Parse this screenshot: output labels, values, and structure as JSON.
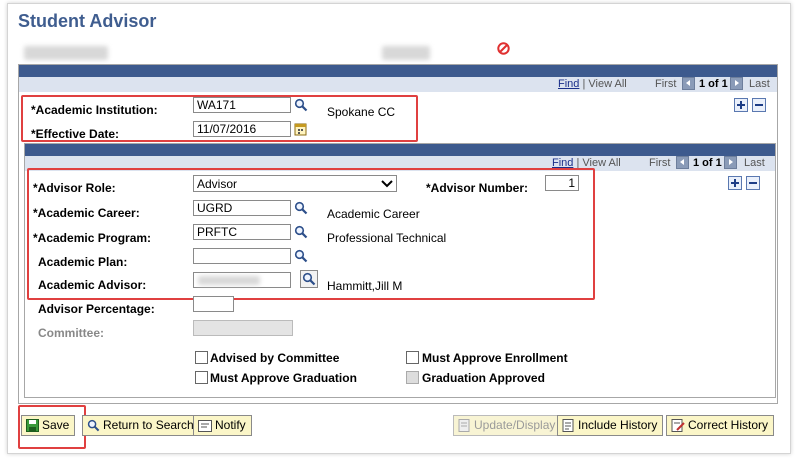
{
  "page": {
    "title": "Student Advisor"
  },
  "nav": {
    "find": "Find",
    "sep": "|",
    "view_all": "View All",
    "first": "First",
    "count": "1 of 1",
    "last": "Last"
  },
  "outer": {
    "institution_label": "*Academic Institution:",
    "institution_value": "WA171",
    "institution_desc": "Spokane CC",
    "effdate_label": "*Effective Date:",
    "effdate_value": "11/07/2016"
  },
  "inner": {
    "role_label": "*Advisor Role:",
    "role_value": "Advisor",
    "number_label": "*Advisor Number:",
    "number_value": "1",
    "career_label": "*Academic Career:",
    "career_value": "UGRD",
    "career_desc": "Academic Career",
    "program_label": "*Academic Program:",
    "program_value": "PRFTC",
    "program_desc": "Professional Technical",
    "plan_label": "Academic Plan:",
    "plan_value": "",
    "advisor_label": "Academic Advisor:",
    "advisor_desc": "Hammitt,Jill M",
    "percentage_label": "Advisor Percentage:",
    "percentage_value": "",
    "committee_label": "Committee:",
    "committee_value": ""
  },
  "checkboxes": {
    "advised_by_committee": "Advised by Committee",
    "must_approve_enrollment": "Must Approve Enrollment",
    "must_approve_graduation": "Must Approve Graduation",
    "graduation_approved": "Graduation Approved"
  },
  "toolbar": {
    "save": "Save",
    "return_to_search": "Return to Search",
    "notify": "Notify",
    "update_display": "Update/Display",
    "include_history": "Include History",
    "correct_history": "Correct History"
  },
  "colors": {
    "title": "#3f5d8f",
    "header": "#3d5a8e",
    "highlight": "#e04040",
    "button": "#fbf6c8"
  }
}
